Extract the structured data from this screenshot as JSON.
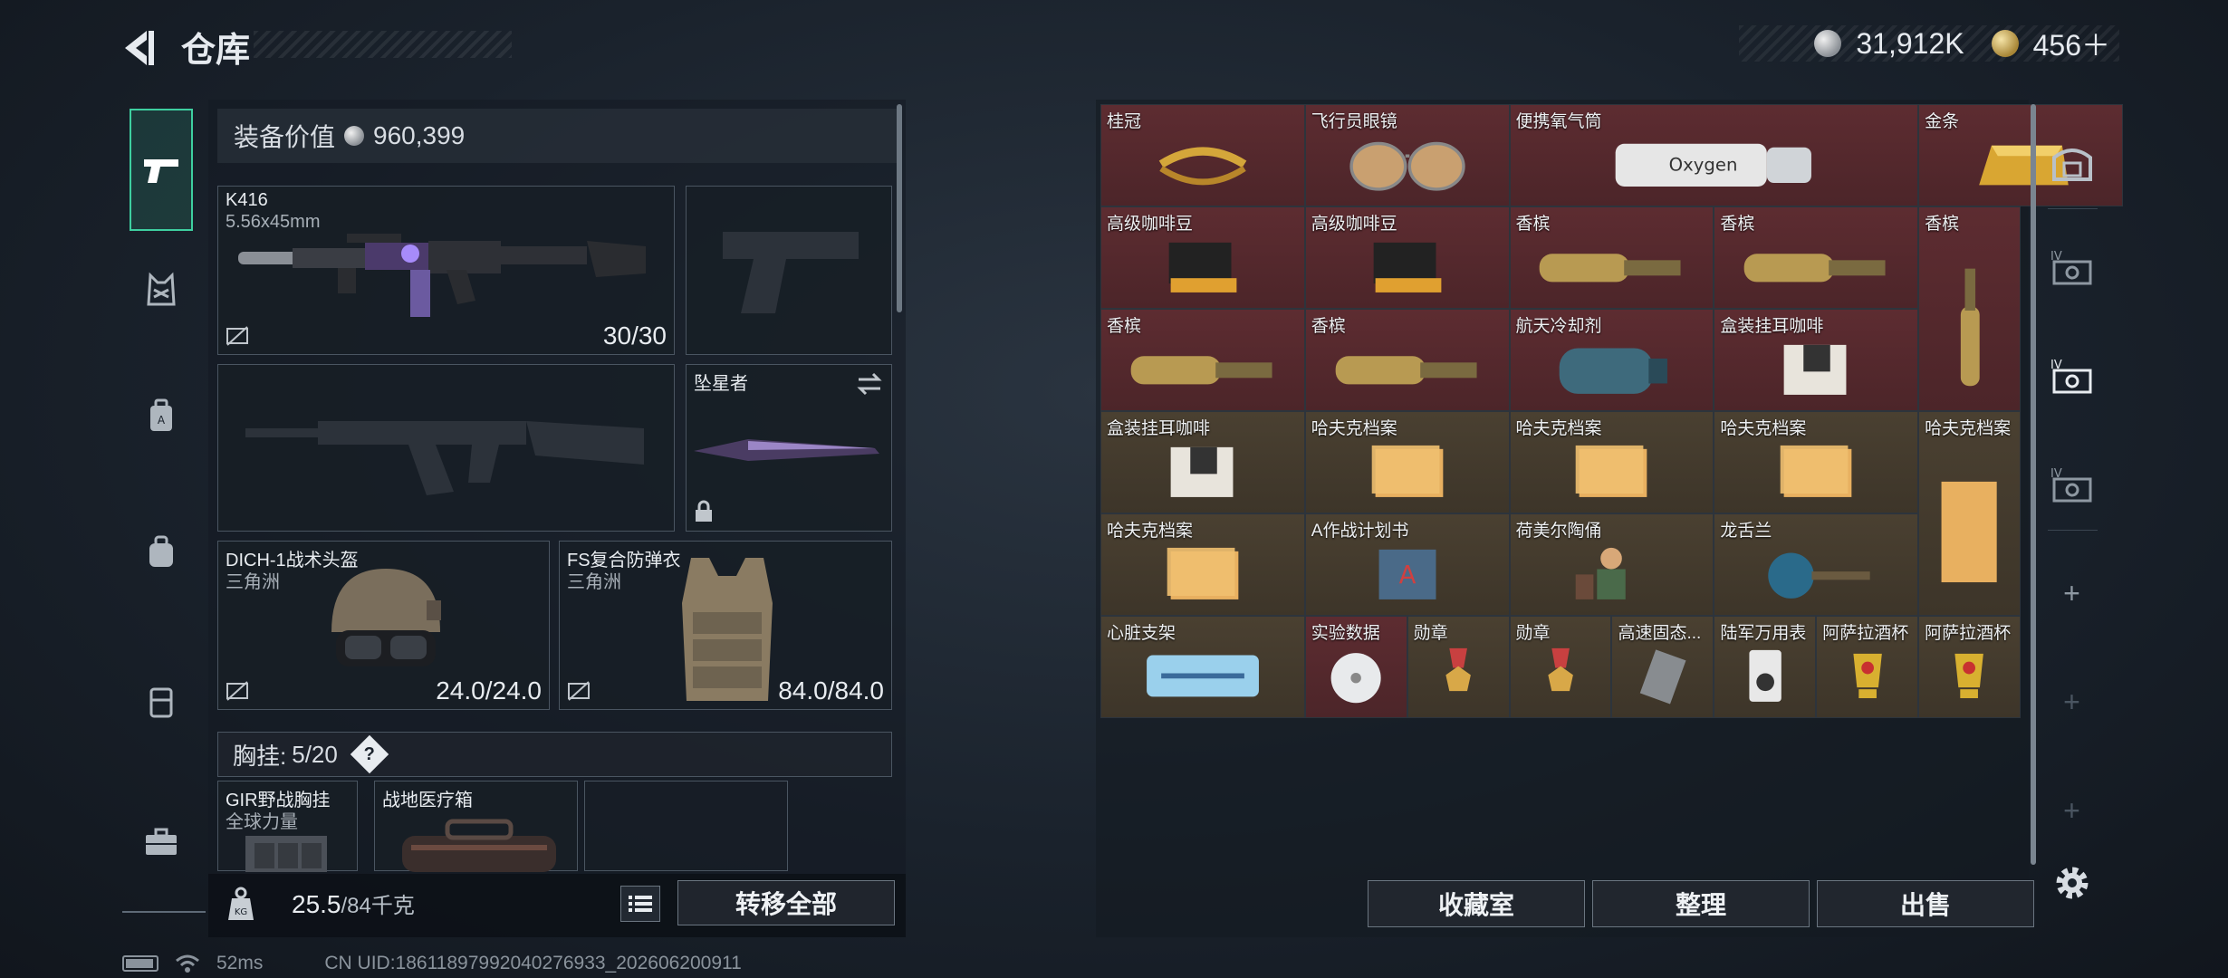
{
  "header": {
    "title": "仓库",
    "currency_silver": "31,912K",
    "currency_gold": "456＋"
  },
  "equipment": {
    "value_label": "装备价值",
    "value": "960,399",
    "primary_weapon": {
      "name": "K416",
      "caliber": "5.56x45mm",
      "ammo": "30/30"
    },
    "melee": {
      "name": "坠星者"
    },
    "helmet": {
      "name": "DICH-1战术头盔",
      "sub": "三角洲",
      "durability": "24.0/24.0"
    },
    "armor": {
      "name": "FS复合防弹衣",
      "sub": "三角洲",
      "durability": "84.0/84.0"
    },
    "vest": {
      "label": "胸挂:",
      "count": "5/20",
      "help": "?"
    },
    "vest_items": [
      {
        "name": "GIR野战胸挂",
        "sub": "全球力量"
      },
      {
        "name": "战地医疗箱"
      }
    ]
  },
  "weight": {
    "current": "25.5",
    "max": "/84千克"
  },
  "actions": {
    "transfer_all": "转移全部",
    "collection": "收藏室",
    "organize": "整理",
    "sell": "出售"
  },
  "inventory": [
    {
      "name": "桂冠",
      "color": "red"
    },
    {
      "name": "飞行员眼镜",
      "color": "red"
    },
    {
      "name": "便携氧气筒",
      "color": "red"
    },
    {
      "name": "金条",
      "color": "red"
    },
    {
      "name": "高级咖啡豆",
      "color": "red"
    },
    {
      "name": "高级咖啡豆",
      "color": "red"
    },
    {
      "name": "香槟",
      "color": "red"
    },
    {
      "name": "香槟",
      "color": "red"
    },
    {
      "name": "香槟",
      "color": "red"
    },
    {
      "name": "香槟",
      "color": "red"
    },
    {
      "name": "香槟",
      "color": "red"
    },
    {
      "name": "航天冷却剂",
      "color": "red"
    },
    {
      "name": "盒装挂耳咖啡",
      "color": "red"
    },
    {
      "name": "盒装挂耳咖啡",
      "color": "brown"
    },
    {
      "name": "哈夫克档案",
      "color": "brown"
    },
    {
      "name": "哈夫克档案",
      "color": "brown"
    },
    {
      "name": "哈夫克档案",
      "color": "brown"
    },
    {
      "name": "哈夫克档案",
      "color": "brown"
    },
    {
      "name": "哈夫克档案",
      "color": "brown"
    },
    {
      "name": "A作战计划书",
      "color": "brown"
    },
    {
      "name": "荷美尔陶俑",
      "color": "brown"
    },
    {
      "name": "龙舌兰",
      "color": "brown"
    },
    {
      "name": "心脏支架",
      "color": "brown"
    },
    {
      "name": "实验数据",
      "color": "red"
    },
    {
      "name": "勋章",
      "color": "brown"
    },
    {
      "name": "勋章",
      "color": "brown"
    },
    {
      "name": "高速固态...",
      "color": "brown"
    },
    {
      "name": "陆军万用表",
      "color": "brown"
    },
    {
      "name": "阿萨拉酒杯",
      "color": "brown"
    },
    {
      "name": "阿萨拉酒杯",
      "color": "brown"
    }
  ],
  "status": {
    "ping": "52ms",
    "uid": "CN UID:18611897992040276933_202606200911"
  }
}
